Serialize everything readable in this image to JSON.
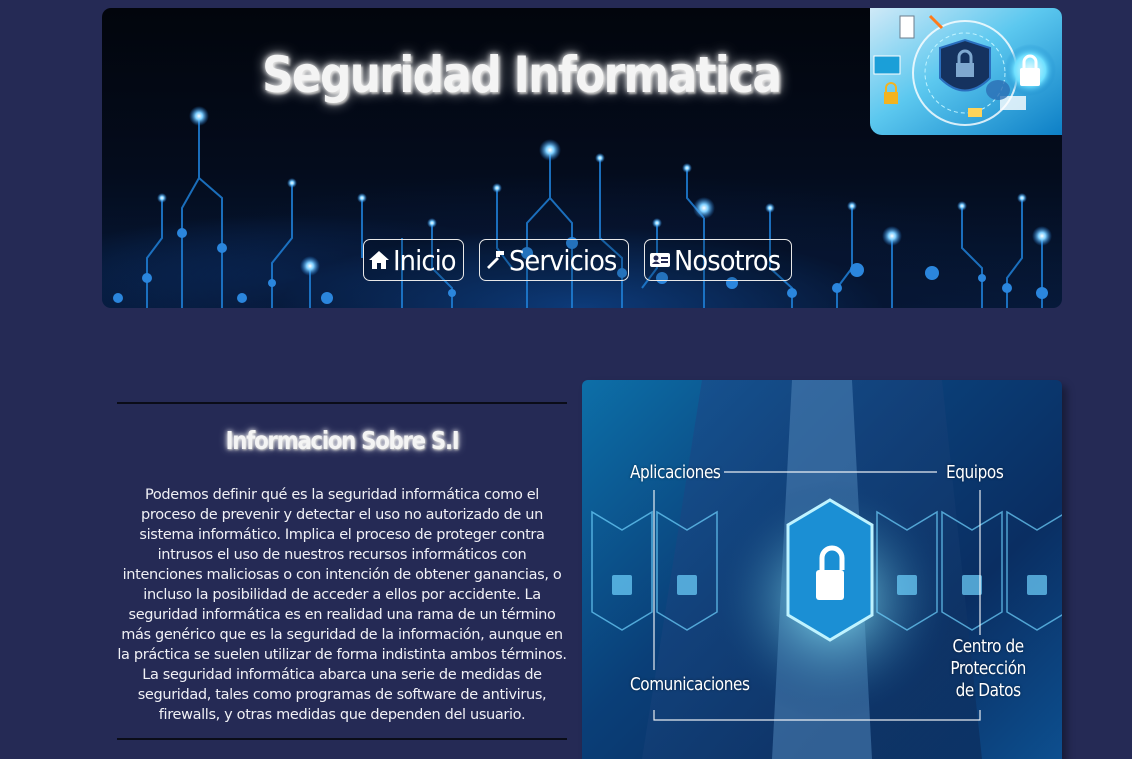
{
  "header": {
    "title": "Seguridad Informatica",
    "logo_icon": "security-collage-icon"
  },
  "nav": {
    "items": [
      {
        "label": "Inicio",
        "icon": "home-icon"
      },
      {
        "label": "Servicios",
        "icon": "hammer-icon"
      },
      {
        "label": "Nosotros",
        "icon": "id-card-icon"
      }
    ]
  },
  "info": {
    "title": "Informacion Sobre S.I",
    "text": "Podemos definir qué es la seguridad informática como el proceso de prevenir y detectar el uso no autorizado de un sistema informático. Implica el proceso de proteger contra intrusos el uso de nuestros recursos informáticos con intenciones maliciosas o con intención de obtener ganancias, o incluso la posibilidad de acceder a ellos por accidente. La seguridad informática es en realidad una rama de un término más genérico que es la seguridad de la información, aunque en la práctica se suelen utilizar de forma indistinta ambos términos. La seguridad informática abarca una serie de medidas de seguridad, tales como programas de software de antivirus, firewalls, y otras medidas que dependen del usuario."
  },
  "photo": {
    "labels": {
      "top_left": "Aplicaciones",
      "top_right": "Equipos",
      "bottom_left": "Comunicaciones",
      "bottom_right_1": "Centro de",
      "bottom_right_2": "Protección",
      "bottom_right_3": "de Datos"
    }
  },
  "colors": {
    "page_background": "#252a55",
    "banner_dark": "#02050c",
    "glow_blue": "#3fa9ff",
    "text_white": "#ffffff"
  }
}
